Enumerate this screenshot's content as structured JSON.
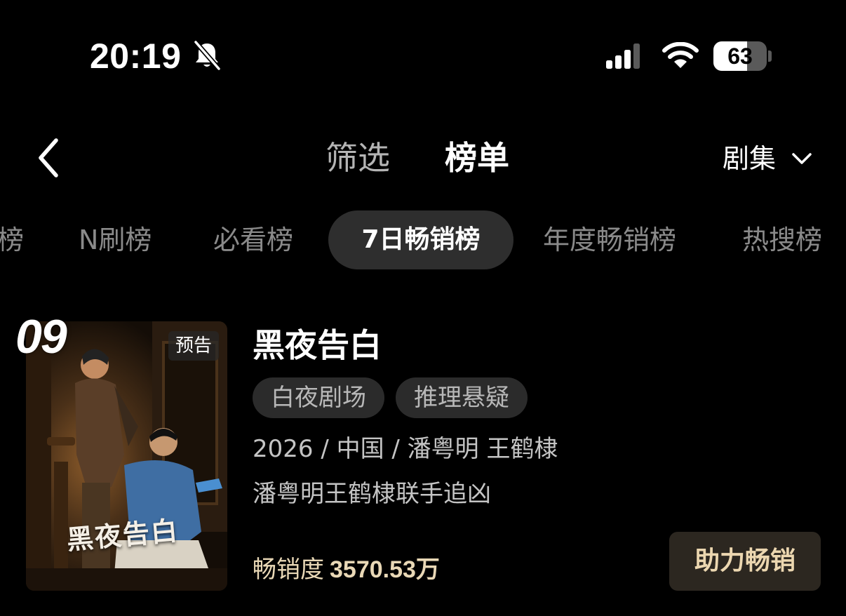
{
  "status_bar": {
    "time": "20:19",
    "battery": "63",
    "battery_level": 0.63,
    "icons": [
      "bell-muted-icon",
      "cellular-signal-icon",
      "wifi-icon",
      "battery-icon"
    ]
  },
  "header": {
    "tabs": [
      {
        "label": "筛选",
        "active": false
      },
      {
        "label": "榜单",
        "active": true
      }
    ],
    "category": "剧集",
    "icons": [
      "back-chevron-icon",
      "chevron-down-icon"
    ]
  },
  "rank_tabs": [
    {
      "label": "榜",
      "active": false
    },
    {
      "label": "N刷榜",
      "active": false
    },
    {
      "label": "必看榜",
      "active": false
    },
    {
      "label": "7日畅销榜",
      "active": true
    },
    {
      "label": "年度畅销榜",
      "active": false
    },
    {
      "label": "热搜榜",
      "active": false
    }
  ],
  "item": {
    "rank": "09",
    "badge": "预告",
    "poster_title": "黑夜告白",
    "title": "黑夜告白",
    "tags": [
      "白夜剧场",
      "推理悬疑"
    ],
    "meta": "2026 / 中国 / 潘粤明 王鹤棣",
    "description": "潘粤明王鹤棣联手追凶",
    "sales_label": "畅销度",
    "sales_value": "3570.53万",
    "action_label": "助力畅销"
  },
  "colors": {
    "background": "#000000",
    "active_tab_bg": "#2e2e2e",
    "tag_bg": "#2b2b2b",
    "accent_gold": "#e9d8b6",
    "action_button_bg": "#2c2720"
  }
}
